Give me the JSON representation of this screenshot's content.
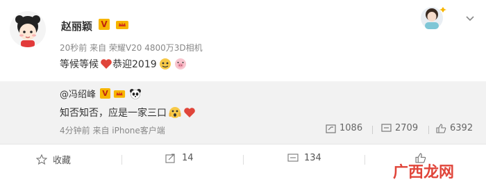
{
  "post": {
    "author": "赵丽颖",
    "meta": "20秒前  来自 荣耀V20 4800万3D相机",
    "text_part1": "等候等候",
    "text_part2": "恭迎2019"
  },
  "repost": {
    "author": "@冯绍峰",
    "text": "知否知否，应是一家三口",
    "time": "4分钟前  来自 iPhone客户端",
    "reposts": "1086",
    "comments": "2709",
    "likes": "6392"
  },
  "actions": {
    "favorite_label": "收藏",
    "share_count": "14",
    "comment_count": "134"
  },
  "watermark": "广西龙网",
  "colors": {
    "accent": "#f7b500",
    "heart": "#e0453a",
    "repost_bg": "#f2f2f2"
  }
}
